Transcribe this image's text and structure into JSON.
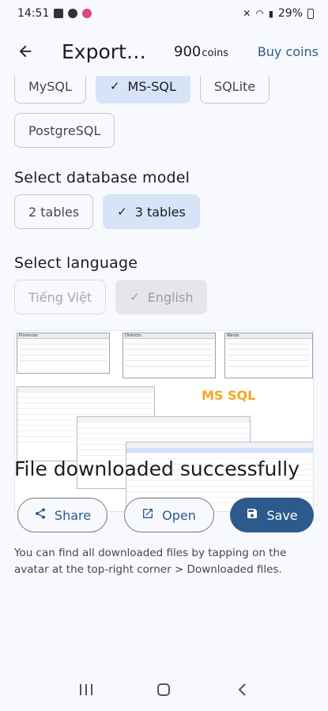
{
  "status_bar": {
    "time": "14:51",
    "battery": "29%"
  },
  "app_bar": {
    "title": "Export…",
    "coins_value": "900",
    "coins_unit": "coins",
    "buy_coins_label": "Buy coins"
  },
  "db_types": {
    "options": [
      "MySQL",
      "MS-SQL",
      "SQLite",
      "PostgreSQL"
    ],
    "selected": "MS-SQL"
  },
  "db_model": {
    "title": "Select database model",
    "options": [
      "2 tables",
      "3 tables"
    ],
    "selected": "3 tables"
  },
  "language": {
    "title": "Select language",
    "options": [
      "Tiếng Việt",
      "English"
    ],
    "selected": "English"
  },
  "preview": {
    "table_names": [
      "Provinces",
      "Districts",
      "Wards"
    ],
    "label": "MS SQL"
  },
  "result": {
    "message": "File downloaded successfully",
    "share_label": "Share",
    "open_label": "Open",
    "save_label": "Save",
    "hint": "You can find all downloaded files by tapping on the avatar at the top-right corner > Downloaded files."
  },
  "colors": {
    "accent": "#2d5a8c",
    "chip_selected": "#d7e3f7",
    "ms_sql_label": "#f5a623"
  }
}
